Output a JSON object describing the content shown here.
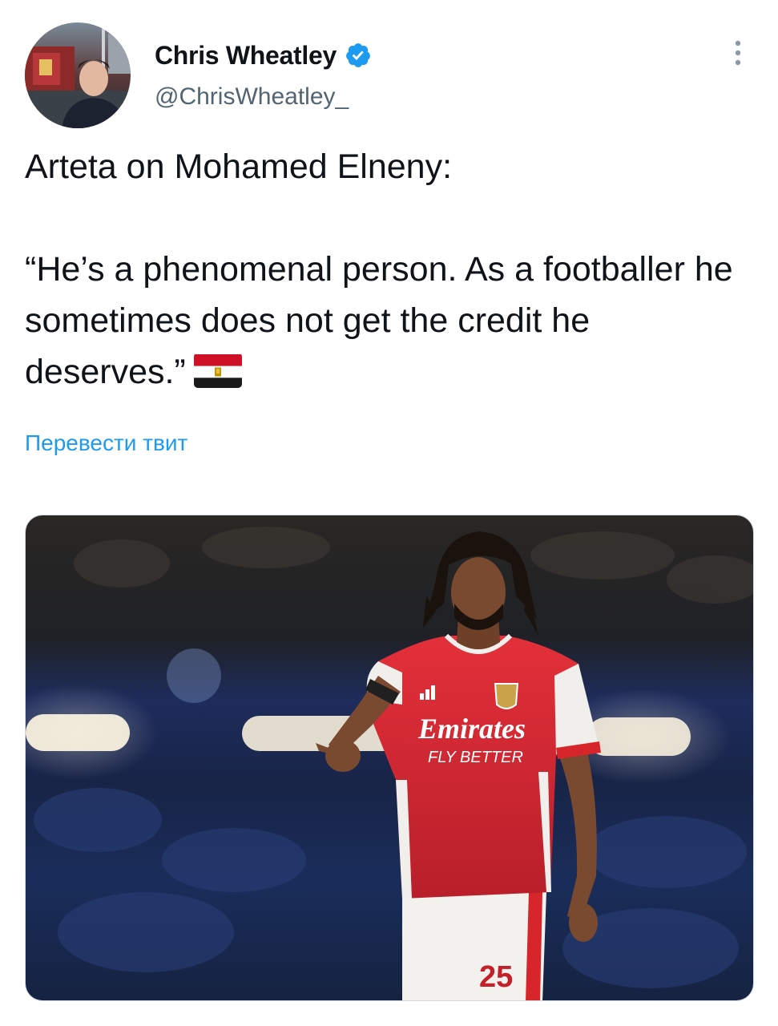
{
  "author": {
    "display_name": "Chris Wheatley",
    "handle": "@ChrisWheatley_",
    "verified": true
  },
  "tweet": {
    "text_line1": "Arteta on Mohamed Elneny:",
    "text_quote": "“He’s a phenomenal person. As a footballer he sometimes does not get the credit he deserves.”",
    "emoji": "egypt-flag",
    "translate_label": "Перевести твит"
  },
  "media": {
    "type": "photo",
    "shirt_sponsor": "Emirates",
    "shirt_tagline": "FLY BETTER",
    "shirt_number": "25"
  },
  "colors": {
    "link": "#1d9bf0",
    "verified": "#1d9bf0",
    "secondary_text": "#536471",
    "arsenal_red": "#d7262b"
  }
}
